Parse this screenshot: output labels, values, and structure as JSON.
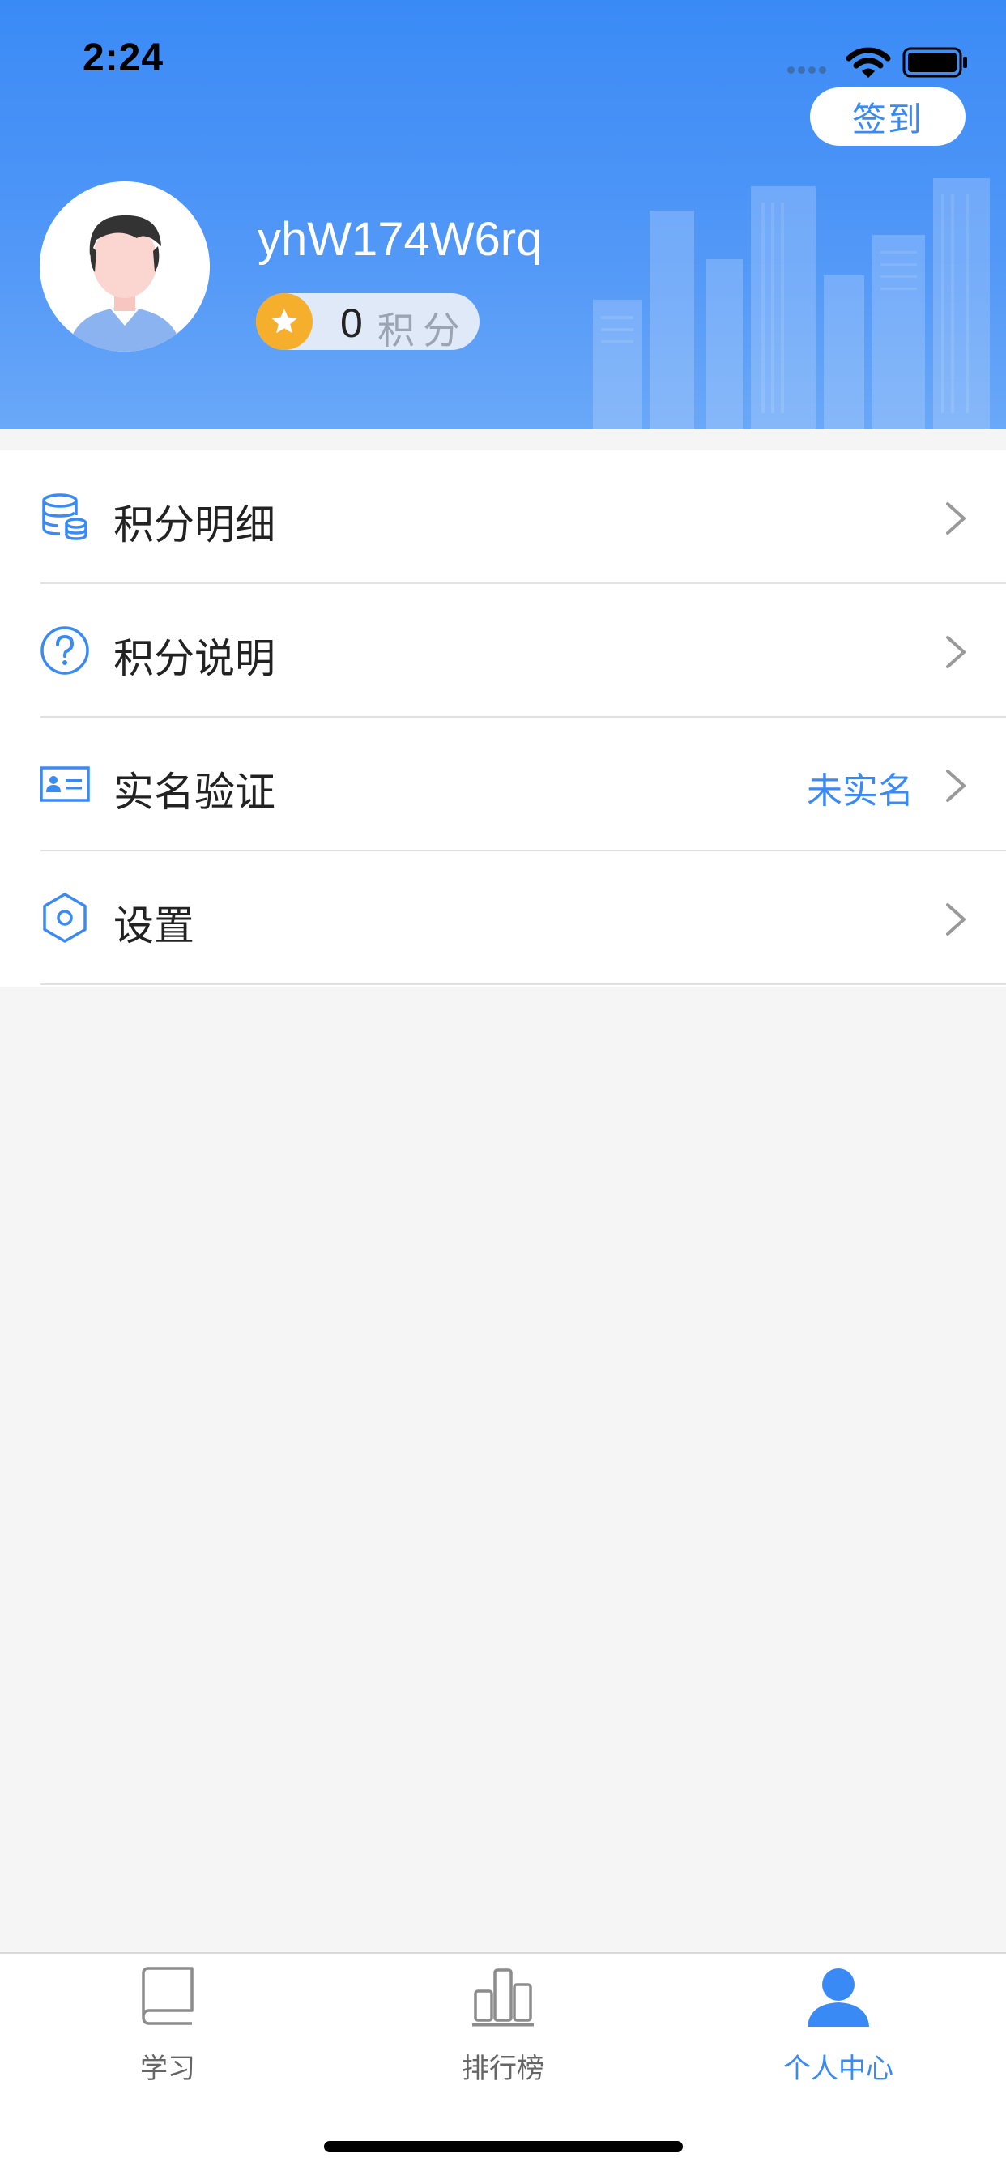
{
  "status_bar": {
    "time": "2:24"
  },
  "header": {
    "signin_label": "签到",
    "username": "yhW174W6rq",
    "points_value": "0",
    "points_unit": "积分"
  },
  "menu": {
    "items": [
      {
        "label": "积分明细",
        "icon": "database-coins-icon",
        "value": ""
      },
      {
        "label": "积分说明",
        "icon": "question-circle-icon",
        "value": ""
      },
      {
        "label": "实名验证",
        "icon": "id-card-icon",
        "value": "未实名"
      },
      {
        "label": "设置",
        "icon": "settings-hexagon-icon",
        "value": ""
      }
    ]
  },
  "tabbar": {
    "tabs": [
      {
        "label": "学习",
        "icon": "book-icon",
        "active": false
      },
      {
        "label": "排行榜",
        "icon": "ranking-bars-icon",
        "active": false
      },
      {
        "label": "个人中心",
        "icon": "person-icon",
        "active": true
      }
    ]
  },
  "colors": {
    "accent": "#3a8af6",
    "header_top": "#3a8af6",
    "header_bottom": "#6aa8f8",
    "star": "#f6ae2d",
    "background": "#f5f5f5",
    "inactive_tab": "#666666"
  }
}
